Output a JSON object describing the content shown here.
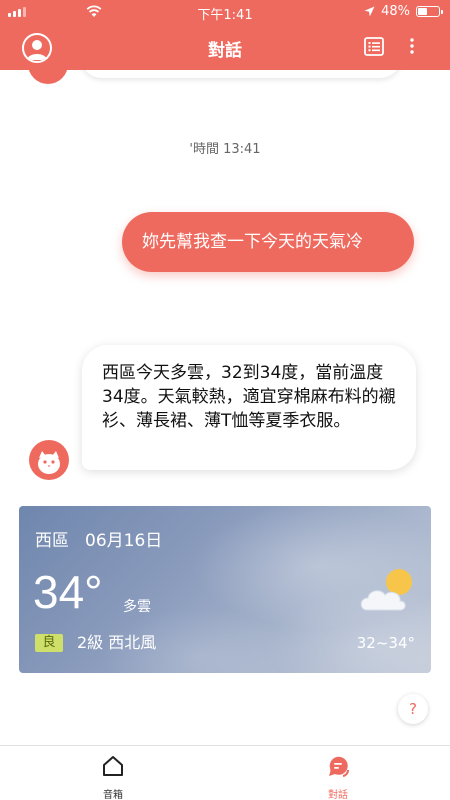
{
  "status_bar": {
    "time": "下午1:41",
    "battery_text": "48%",
    "battery_level": 0.48
  },
  "header": {
    "title": "對話"
  },
  "chat": {
    "timestamp": "'時間 13:41",
    "user_message": "妳先幫我查一下今天的天氣冷",
    "bot_message": "西區今天多雲，32到34度，當前溫度34度。天氣較熱，適宜穿棉麻布料的襯衫、薄長裙、薄T恤等夏季衣服。"
  },
  "weather_card": {
    "location": "西區",
    "date": "06月16日",
    "temperature": "34°",
    "condition": "多雲",
    "air_quality": "良",
    "wind": "2級 西北風",
    "range": "32~34°",
    "icon": "partly-cloudy-icon"
  },
  "help_button": {
    "label": "?"
  },
  "bottom_nav": {
    "items": [
      {
        "label": "音箱",
        "icon": "home-icon",
        "active": false
      },
      {
        "label": "對話",
        "icon": "chat-icon",
        "active": true
      }
    ]
  },
  "colors": {
    "accent": "#ef6a5e",
    "aqi_badge": "#cfe06a"
  }
}
